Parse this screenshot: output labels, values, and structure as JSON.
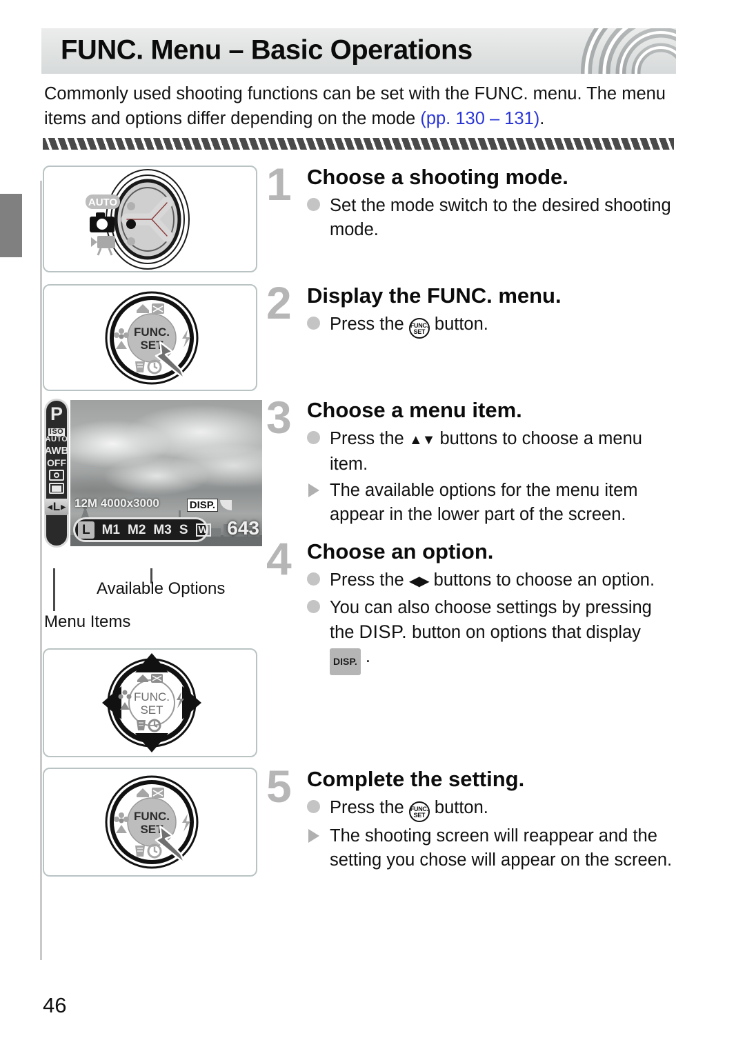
{
  "header": {
    "title": "FUNC. Menu – Basic Operations",
    "arcs_icon": "concentric-arcs-decoration"
  },
  "intro": {
    "line1": "Commonly used shooting functions can be set with the FUNC. menu. The",
    "line2_before": "menu items and options differ depending on the mode ",
    "page_ref": "(pp. 130 – 131)",
    "line2_after": ".",
    "page_ref_color": "#2a35d6"
  },
  "illustrations": {
    "mode_switch": {
      "auto_label": "AUTO",
      "camera_icon": "still-camera-icon",
      "movie_icon": "movie-camera-icon",
      "switch_icon": "mode-switch-dial"
    },
    "func_dial": {
      "center_line1": "FUNC.",
      "center_line2": "SET",
      "top_icon": "exposure-compensation-icon",
      "left_icon": "macro-icon",
      "right_icon": "flash-icon",
      "bottom_icon": "self-timer-delete-icon",
      "pointer_icon": "finger-pointer-icon"
    },
    "four_way": {
      "center_line1": "FUNC.",
      "center_line2": "SET",
      "up_icon": "up-arrow-icon",
      "down_icon": "down-arrow-icon",
      "left_icon": "left-arrow-icon",
      "right_icon": "right-arrow-icon",
      "top_label_icon": "exposure-compensation-icon",
      "left_label_icon": "macro-icon",
      "right_label_icon": "flash-icon",
      "bottom_label_icon": "self-timer-delete-icon"
    }
  },
  "camera_screen": {
    "menu_items": [
      {
        "id": "shooting-mode",
        "label": "P"
      },
      {
        "id": "iso",
        "label": "ISO",
        "sub": "AUTO"
      },
      {
        "id": "white-balance",
        "label": "AWB"
      },
      {
        "id": "my-colors",
        "label": "OFF"
      },
      {
        "id": "metering",
        "label": "metering-icon"
      },
      {
        "id": "drive-mode",
        "label": "drive-mode-icon"
      },
      {
        "id": "resolution",
        "label": "L",
        "selected": true
      }
    ],
    "info_text": "12M 4000x3000",
    "disp_label": "DISP.",
    "options": [
      {
        "label": "L",
        "selected": true
      },
      {
        "label": "M1",
        "selected": false
      },
      {
        "label": "M2",
        "selected": false
      },
      {
        "label": "M3",
        "selected": false
      },
      {
        "label": "S",
        "selected": false
      },
      {
        "label": "W",
        "selected": false,
        "boxed": true
      }
    ],
    "shots_remaining": "643"
  },
  "callouts": {
    "available_options": "Available Options",
    "menu_items": "Menu Items"
  },
  "steps": [
    {
      "number": "1",
      "heading": "Choose a shooting mode.",
      "bullets": [
        {
          "marker": "dot",
          "text": "Set the mode switch to the desired shooting mode."
        }
      ]
    },
    {
      "number": "2",
      "heading": "Display the FUNC. menu.",
      "bullets": [
        {
          "marker": "dot",
          "text_before": "Press the ",
          "icon": "func-set-button-icon",
          "text_after": " button."
        }
      ]
    },
    {
      "number": "3",
      "heading": "Choose a menu item.",
      "bullets": [
        {
          "marker": "dot",
          "text_before": "Press the ",
          "icon": "up-down-buttons-icon",
          "text_after": " buttons to choose a menu item."
        },
        {
          "marker": "triangle",
          "text": "The available options for the menu item appear in the lower part of the screen."
        }
      ]
    },
    {
      "number": "4",
      "heading": "Choose an option.",
      "bullets": [
        {
          "marker": "dot",
          "text_before": "Press the ",
          "icon": "left-right-buttons-icon",
          "text_after": " buttons to choose an option."
        },
        {
          "marker": "dot",
          "text_before": "You can also choose settings by pressing the ",
          "icon": "disp-button-word",
          "text_mid": " button on options that display ",
          "icon2": "disp-chip-icon",
          "text_after": " ."
        }
      ]
    },
    {
      "number": "5",
      "heading": "Complete the setting.",
      "bullets": [
        {
          "marker": "dot",
          "text_before": "Press the ",
          "icon": "func-set-button-icon",
          "text_after": " button."
        },
        {
          "marker": "triangle",
          "text": "The shooting screen will reappear and the setting you chose will appear on the screen."
        }
      ]
    }
  ],
  "folio": "46"
}
